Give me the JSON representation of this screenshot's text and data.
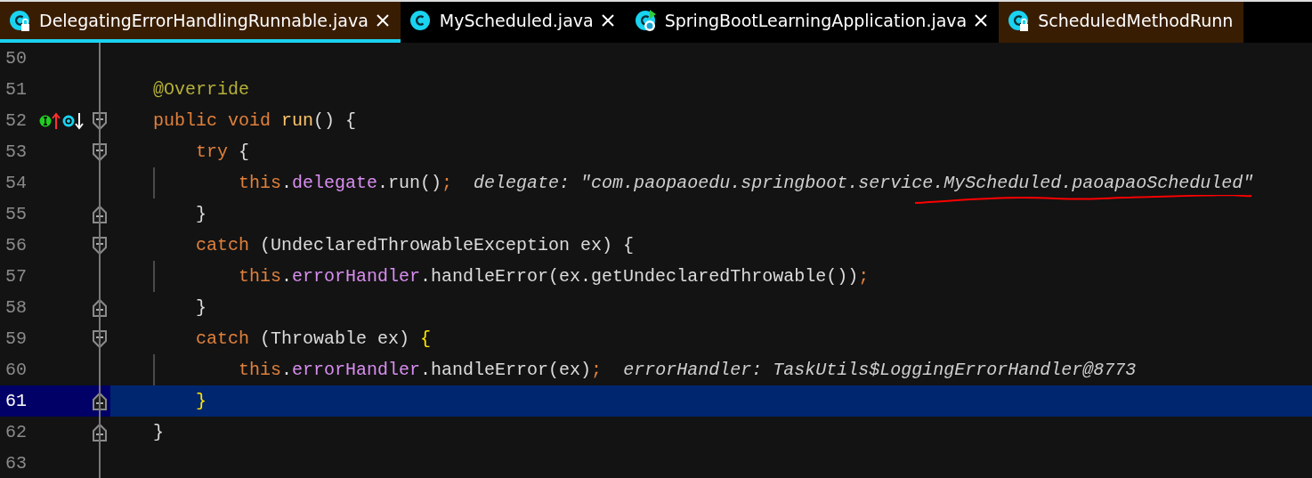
{
  "tabs": [
    {
      "label": "DelegatingErrorHandlingRunnable.java",
      "kind": "class",
      "locked": true,
      "selected": true,
      "closable": true
    },
    {
      "label": "MyScheduled.java",
      "kind": "class",
      "locked": false,
      "selected": false,
      "closable": true
    },
    {
      "label": "SpringBootLearningApplication.java",
      "kind": "app",
      "locked": false,
      "selected": false,
      "closable": true
    },
    {
      "label": "ScheduledMethodRunn",
      "kind": "class",
      "locked": true,
      "selected": false,
      "closable": false
    }
  ],
  "lines": [
    {
      "number": "50",
      "fold_open": false,
      "fold_close": false,
      "current": false
    },
    {
      "number": "51",
      "tokens": [
        {
          "text": "    @Override",
          "kind": "annotation"
        }
      ],
      "fold_open": false,
      "fold_close": false,
      "current": false
    },
    {
      "number": "52",
      "gutter_icons": [
        {
          "kind": "implements"
        },
        {
          "kind": "overridden"
        }
      ],
      "tokens": [
        {
          "text": "    public void ",
          "kind": "keyword"
        },
        {
          "text": "run",
          "kind": "method"
        },
        {
          "text": "() {",
          "kind": "plain"
        }
      ],
      "fold_open": true,
      "fold_close": false,
      "current": false
    },
    {
      "number": "53",
      "tokens": [
        {
          "text": "        try",
          "kind": "keyword"
        },
        {
          "text": " {",
          "kind": "plain"
        }
      ],
      "fold_open": true,
      "fold_close": false,
      "current": false
    },
    {
      "number": "54",
      "tokens": [
        {
          "text": "            this",
          "kind": "keyword"
        },
        {
          "text": ".",
          "kind": "plain"
        },
        {
          "text": "delegate",
          "kind": "field"
        },
        {
          "text": ".run()",
          "kind": "plain"
        },
        {
          "text": ";",
          "kind": "keyword"
        },
        {
          "text": "delegate: \"com.paopaoedu.springboot.service.MyScheduled.paoapaoScheduled\"",
          "kind": "hint",
          "underlined": true
        }
      ],
      "fold_open": false,
      "fold_close": false,
      "current": false
    },
    {
      "number": "55",
      "tokens": [
        {
          "text": "        }",
          "kind": "plain"
        }
      ],
      "fold_open": false,
      "fold_close": true,
      "current": false
    },
    {
      "number": "56",
      "tokens": [
        {
          "text": "        catch",
          "kind": "keyword"
        },
        {
          "text": " (UndeclaredThrowableException ex) {",
          "kind": "plain"
        }
      ],
      "fold_open": true,
      "fold_close": false,
      "current": false
    },
    {
      "number": "57",
      "tokens": [
        {
          "text": "            this",
          "kind": "keyword"
        },
        {
          "text": ".",
          "kind": "plain"
        },
        {
          "text": "errorHandler",
          "kind": "field"
        },
        {
          "text": ".handleError(ex.getUndeclaredThrowable())",
          "kind": "plain"
        },
        {
          "text": ";",
          "kind": "keyword"
        }
      ],
      "fold_open": false,
      "fold_close": false,
      "current": false
    },
    {
      "number": "58",
      "tokens": [
        {
          "text": "        }",
          "kind": "plain"
        }
      ],
      "fold_open": false,
      "fold_close": true,
      "current": false
    },
    {
      "number": "59",
      "tokens": [
        {
          "text": "        catch",
          "kind": "keyword"
        },
        {
          "text": " (Throwable ex) ",
          "kind": "plain"
        },
        {
          "text": "{",
          "kind": "brace-match"
        }
      ],
      "fold_open": true,
      "fold_close": false,
      "current": false
    },
    {
      "number": "60",
      "tokens": [
        {
          "text": "            this",
          "kind": "keyword"
        },
        {
          "text": ".",
          "kind": "plain"
        },
        {
          "text": "errorHandler",
          "kind": "field"
        },
        {
          "text": ".handleError(ex)",
          "kind": "plain"
        },
        {
          "text": ";",
          "kind": "keyword"
        },
        {
          "text": "errorHandler: TaskUtils$LoggingErrorHandler@8773",
          "kind": "hint"
        }
      ],
      "fold_open": false,
      "fold_close": false,
      "current": false
    },
    {
      "number": "61",
      "tokens": [
        {
          "text": "        }",
          "kind": "brace-match"
        }
      ],
      "fold_open": false,
      "fold_close": true,
      "current": true
    },
    {
      "number": "62",
      "tokens": [
        {
          "text": "    }",
          "kind": "plain"
        }
      ],
      "fold_open": false,
      "fold_close": true,
      "current": false
    },
    {
      "number": "63",
      "fold_open": false,
      "fold_close": false,
      "current": false
    }
  ]
}
